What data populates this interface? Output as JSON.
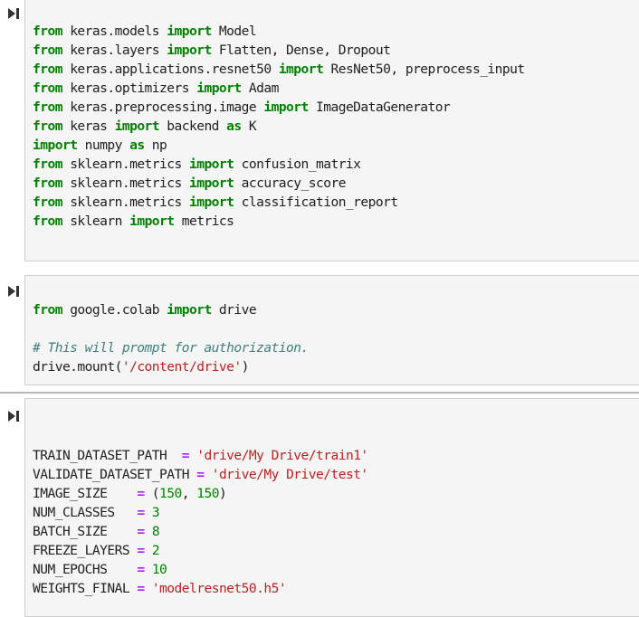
{
  "cells": [
    {
      "run_icon": "run-cell-icon",
      "lines": [
        [
          [
            "kw",
            "from"
          ],
          [
            "t",
            " keras.models "
          ],
          [
            "kw",
            "import"
          ],
          [
            "t",
            " Model"
          ]
        ],
        [
          [
            "kw",
            "from"
          ],
          [
            "t",
            " keras.layers "
          ],
          [
            "kw",
            "import"
          ],
          [
            "t",
            " Flatten, Dense, Dropout"
          ]
        ],
        [
          [
            "kw",
            "from"
          ],
          [
            "t",
            " keras.applications.resnet50 "
          ],
          [
            "kw",
            "import"
          ],
          [
            "t",
            " ResNet50, preprocess_input"
          ]
        ],
        [
          [
            "kw",
            "from"
          ],
          [
            "t",
            " keras.optimizers "
          ],
          [
            "kw",
            "import"
          ],
          [
            "t",
            " Adam"
          ]
        ],
        [
          [
            "kw",
            "from"
          ],
          [
            "t",
            " keras.preprocessing.image "
          ],
          [
            "kw",
            "import"
          ],
          [
            "t",
            " ImageDataGenerator"
          ]
        ],
        [
          [
            "kw",
            "from"
          ],
          [
            "t",
            " keras "
          ],
          [
            "kw",
            "import"
          ],
          [
            "t",
            " backend "
          ],
          [
            "kw",
            "as"
          ],
          [
            "t",
            " K"
          ]
        ],
        [
          [
            "kw",
            "import"
          ],
          [
            "t",
            " numpy "
          ],
          [
            "kw",
            "as"
          ],
          [
            "t",
            " np"
          ]
        ],
        [
          [
            "kw",
            "from"
          ],
          [
            "t",
            " sklearn.metrics "
          ],
          [
            "kw",
            "import"
          ],
          [
            "t",
            " confusion_matrix"
          ]
        ],
        [
          [
            "kw",
            "from"
          ],
          [
            "t",
            " sklearn.metrics "
          ],
          [
            "kw",
            "import"
          ],
          [
            "t",
            " accuracy_score"
          ]
        ],
        [
          [
            "kw",
            "from"
          ],
          [
            "t",
            " sklearn.metrics "
          ],
          [
            "kw",
            "import"
          ],
          [
            "t",
            " classification_report"
          ]
        ],
        [
          [
            "kw",
            "from"
          ],
          [
            "t",
            " sklearn "
          ],
          [
            "kw",
            "import"
          ],
          [
            "t",
            " metrics"
          ]
        ]
      ]
    },
    {
      "run_icon": "run-cell-icon",
      "lines": [
        [
          [
            "kw",
            "from"
          ],
          [
            "t",
            " google.colab "
          ],
          [
            "kw",
            "import"
          ],
          [
            "t",
            " drive"
          ]
        ],
        [],
        [
          [
            "cm",
            "# This will prompt for authorization."
          ]
        ],
        [
          [
            "t",
            "drive.mount("
          ],
          [
            "str",
            "'/content/drive'"
          ],
          [
            "t",
            ")"
          ]
        ]
      ]
    },
    {
      "run_icon": "run-cell-icon",
      "lines": [
        [
          [
            "t",
            "TRAIN_DATASET_PATH  "
          ],
          [
            "op",
            "="
          ],
          [
            "t",
            " "
          ],
          [
            "str",
            "'drive/My Drive/train1'"
          ]
        ],
        [
          [
            "t",
            "VALIDATE_DATASET_PATH "
          ],
          [
            "op",
            "="
          ],
          [
            "t",
            " "
          ],
          [
            "str",
            "'drive/My Drive/test'"
          ]
        ],
        [
          [
            "t",
            "IMAGE_SIZE    "
          ],
          [
            "op",
            "="
          ],
          [
            "t",
            " ("
          ],
          [
            "num",
            "150"
          ],
          [
            "t",
            ", "
          ],
          [
            "num",
            "150"
          ],
          [
            "t",
            ")"
          ]
        ],
        [
          [
            "t",
            "NUM_CLASSES   "
          ],
          [
            "op",
            "="
          ],
          [
            "t",
            " "
          ],
          [
            "num",
            "3"
          ]
        ],
        [
          [
            "t",
            "BATCH_SIZE    "
          ],
          [
            "op",
            "="
          ],
          [
            "t",
            " "
          ],
          [
            "num",
            "8"
          ]
        ],
        [
          [
            "t",
            "FREEZE_LAYERS "
          ],
          [
            "op",
            "="
          ],
          [
            "t",
            " "
          ],
          [
            "num",
            "2"
          ]
        ],
        [
          [
            "t",
            "NUM_EPOCHS    "
          ],
          [
            "op",
            "="
          ],
          [
            "t",
            " "
          ],
          [
            "num",
            "10"
          ]
        ],
        [
          [
            "t",
            "WEIGHTS_FINAL "
          ],
          [
            "op",
            "="
          ],
          [
            "t",
            " "
          ],
          [
            "str",
            "'modelresnet50.h5'"
          ]
        ]
      ]
    }
  ]
}
